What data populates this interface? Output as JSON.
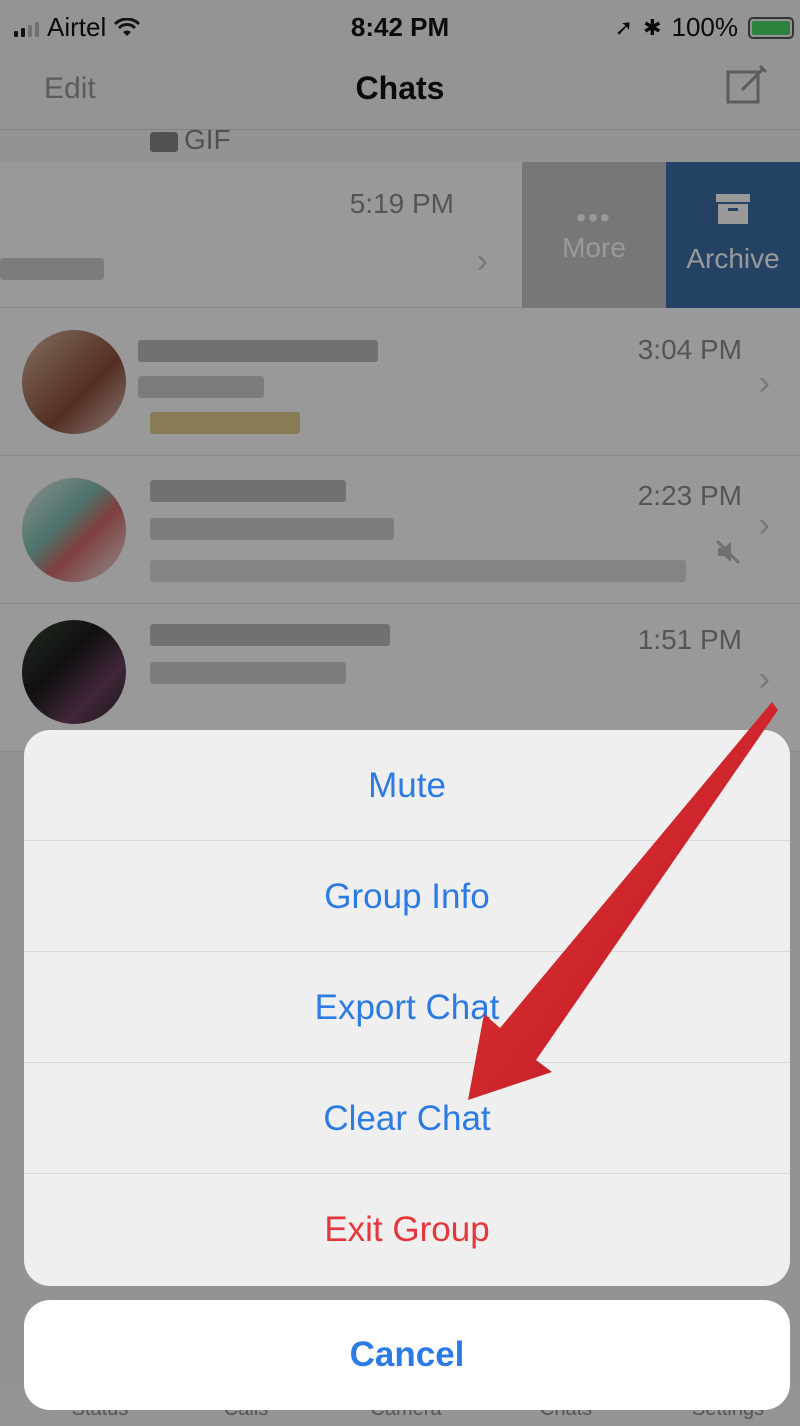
{
  "status_bar": {
    "carrier": "Airtel",
    "time": "8:42 PM",
    "battery": "100%"
  },
  "nav": {
    "edit_label": "Edit",
    "title": "Chats",
    "compose_icon": "compose-icon"
  },
  "chats": {
    "gif_label": "GIF",
    "rows": [
      {
        "time": "5:19 PM"
      },
      {
        "time": "3:04 PM"
      },
      {
        "time": "2:23 PM",
        "muted": true
      },
      {
        "time": "1:51 PM"
      }
    ],
    "swipe_actions": {
      "more_label": "More",
      "archive_label": "Archive"
    }
  },
  "action_sheet": {
    "items": [
      {
        "label": "Mute"
      },
      {
        "label": "Group Info"
      },
      {
        "label": "Export Chat"
      },
      {
        "label": "Clear Chat"
      },
      {
        "label": "Exit Group",
        "destructive": true
      }
    ],
    "cancel_label": "Cancel"
  },
  "tab_bar": {
    "tabs": [
      "Status",
      "Calls",
      "Camera",
      "Chats",
      "Settings"
    ]
  },
  "colors": {
    "accent": "#2c7be5",
    "destructive": "#e6353b",
    "archive": "#3d6fa6",
    "annotation_arrow": "#d81f26"
  }
}
